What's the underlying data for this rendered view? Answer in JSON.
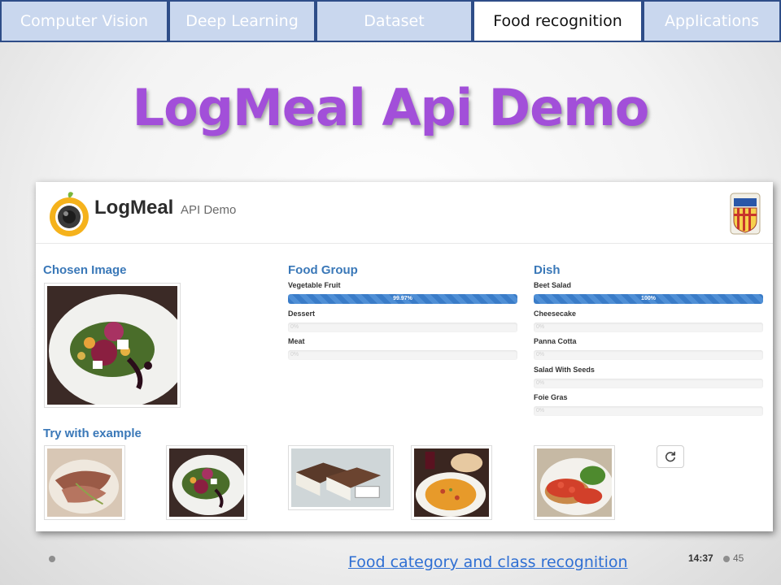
{
  "nav": {
    "tabs": [
      {
        "label": "Computer Vision",
        "active": false
      },
      {
        "label": "Deep Learning",
        "active": false
      },
      {
        "label": "Dataset",
        "active": false
      },
      {
        "label": "Food recognition",
        "active": true
      },
      {
        "label": "Applications",
        "active": false
      }
    ]
  },
  "slide": {
    "title": "LogMeal Api Demo"
  },
  "app": {
    "logo_text": "LogMeal",
    "logo_subtitle": "API Demo",
    "chosen_image_title": "Chosen Image",
    "try_example_title": "Try with example",
    "food_group": {
      "title": "Food Group",
      "predictions": [
        {
          "label": "Vegetable Fruit",
          "percent": 99.97,
          "text": "99.97%"
        },
        {
          "label": "Dessert",
          "percent": 0,
          "text": "0%"
        },
        {
          "label": "Meat",
          "percent": 0,
          "text": "0%"
        }
      ]
    },
    "dish": {
      "title": "Dish",
      "predictions": [
        {
          "label": "Beet Salad",
          "percent": 100,
          "text": "100%"
        },
        {
          "label": "Cheesecake",
          "percent": 0,
          "text": "0%"
        },
        {
          "label": "Panna Cotta",
          "percent": 0,
          "text": "0%"
        },
        {
          "label": "Salad With Seeds",
          "percent": 0,
          "text": "0%"
        },
        {
          "label": "Foie Gras",
          "percent": 0,
          "text": "0%"
        }
      ]
    },
    "refresh_icon": "refresh-icon"
  },
  "footer": {
    "link": "Food category and class recognition",
    "time": "14:37",
    "page": "45"
  },
  "colors": {
    "nav_border": "#2e4d88",
    "nav_tab": "#c9d7ee",
    "title": "#a24fd9",
    "section_title": "#3a78b8",
    "bar": "#3a7cc8",
    "link": "#2f6fd3"
  }
}
